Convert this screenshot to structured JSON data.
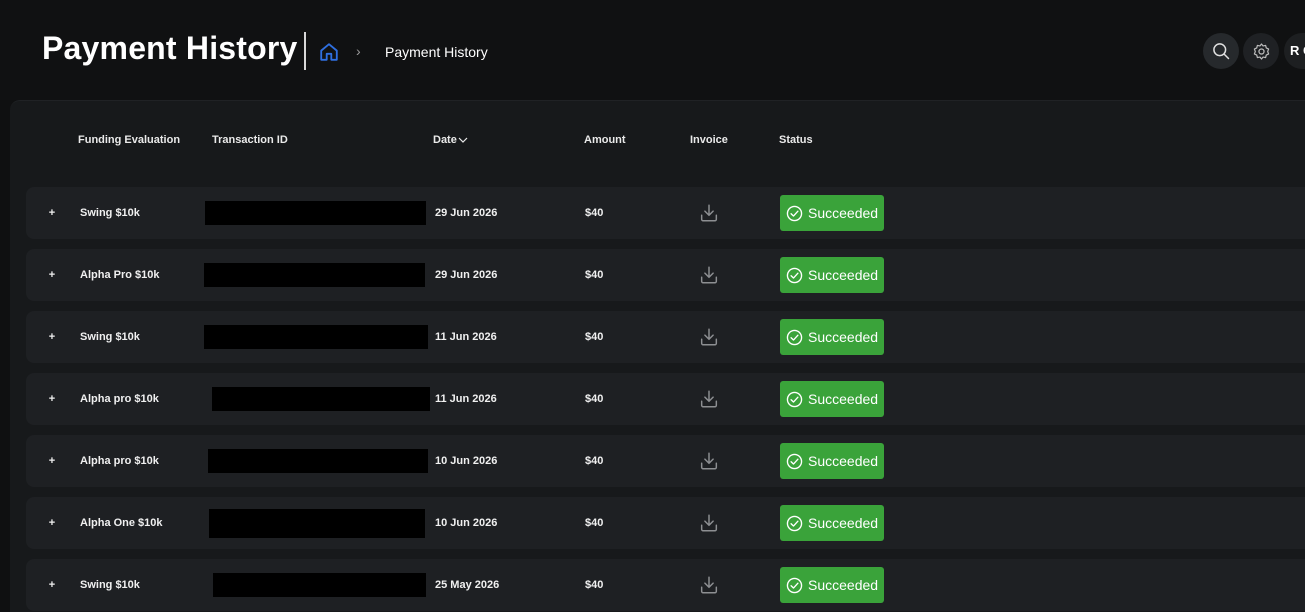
{
  "header": {
    "title": "Payment History",
    "breadcrumb_separator": "›",
    "breadcrumb_current": "Payment History",
    "avatar_initials": "R C"
  },
  "table": {
    "columns": [
      "Funding Evaluation",
      "Transaction ID",
      "Date",
      "Amount",
      "Invoice",
      "Status"
    ],
    "sort_column": "Date",
    "sort_direction": "descending",
    "rows": [
      {
        "evaluation": "Swing $10k",
        "transaction_id": "[redacted]",
        "date": "29 Jun 2026",
        "amount": "$40",
        "status": "Succeeded"
      },
      {
        "evaluation": "Alpha Pro $10k",
        "transaction_id": "[redacted]",
        "date": "29 Jun 2026",
        "amount": "$40",
        "status": "Succeeded"
      },
      {
        "evaluation": "Swing $10k",
        "transaction_id": "[redacted]",
        "date": "11 Jun 2026",
        "amount": "$40",
        "status": "Succeeded"
      },
      {
        "evaluation": "Alpha pro $10k",
        "transaction_id": "[redacted]",
        "date": "11 Jun 2026",
        "amount": "$40",
        "status": "Succeeded"
      },
      {
        "evaluation": "Alpha pro $10k",
        "transaction_id": "[redacted]",
        "date": "10 Jun 2026",
        "amount": "$40",
        "status": "Succeeded"
      },
      {
        "evaluation": "Alpha One $10k",
        "transaction_id": "[redacted]",
        "date": "10 Jun 2026",
        "amount": "$40",
        "status": "Succeeded"
      },
      {
        "evaluation": "Swing $10k",
        "transaction_id": "[redacted]",
        "date": "25 May 2026",
        "amount": "$40",
        "status": "Succeeded"
      }
    ]
  },
  "icons": {
    "home": "home-icon",
    "search": "search-icon",
    "settings": "gear-icon",
    "expand": "plus-icon",
    "invoice": "download-icon",
    "status": "check-circle-icon",
    "sort": "chevron-down-icon"
  },
  "colors": {
    "background": "#0f1011",
    "panel": "#17191b",
    "row": "#1e2023",
    "accent_home": "#2f6fe0",
    "success": "#3aa33a",
    "redaction": "#000000"
  }
}
